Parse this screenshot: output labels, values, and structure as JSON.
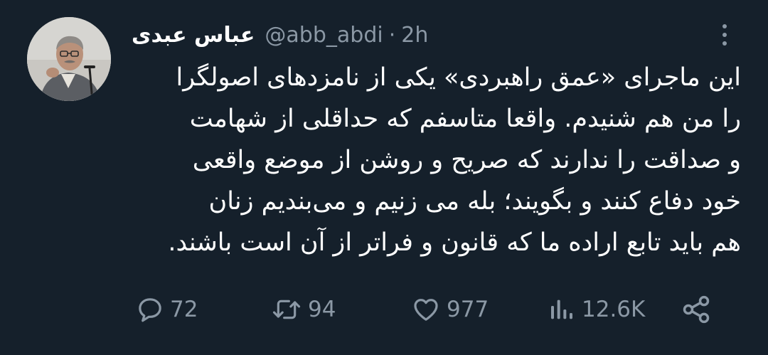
{
  "tweet": {
    "author": {
      "display_name": "عباس عبدی",
      "handle": "@abb_abdi",
      "separator": "·",
      "time": "2h"
    },
    "text_lines": [
      "این ماجرای «عمق راهبردی» یکی از نامزدهای اصولگرا",
      "را من هم شنیدم. واقعا متاسفم که حداقلی از شهامت",
      "و صداقت را ندارند که صریح و روشن از موضع واقعی",
      "خود دفاع کنند و بگویند؛ بله می زنیم و می‌بندیم زنان",
      "هم باید تابع اراده ما که قانون و فراتر از آن است باشند."
    ],
    "actions": {
      "replies": "72",
      "retweets": "94",
      "likes": "977",
      "views": "12.6K"
    }
  },
  "colors": {
    "background": "#15202b",
    "text": "#ffffff",
    "muted": "#8b98a5"
  },
  "icons": {
    "reply": "speech-bubble-icon",
    "retweet": "retweet-arrows-icon",
    "like": "heart-icon",
    "views": "bar-chart-icon",
    "share": "share-nodes-icon",
    "more": "vertical-ellipsis-icon"
  }
}
